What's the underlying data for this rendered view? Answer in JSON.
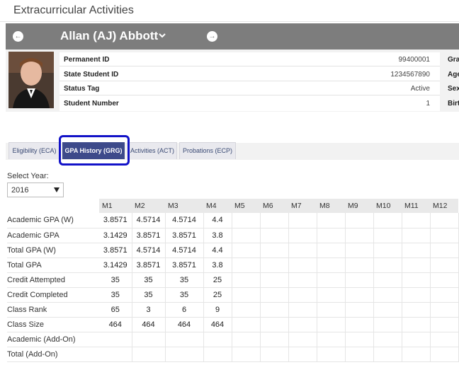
{
  "page": {
    "title": "Extracurricular Activities"
  },
  "student": {
    "name": "Allan (AJ) Abbott",
    "photo_alt": "student photo",
    "fields": [
      {
        "label": "Permanent ID",
        "value": "99400001"
      },
      {
        "label": "State Student ID",
        "value": "1234567890"
      },
      {
        "label": "Status Tag",
        "value": "Active"
      },
      {
        "label": "Student Number",
        "value": "1"
      }
    ],
    "right_labels": [
      "Gra",
      "Age",
      "Sex",
      "Birt"
    ]
  },
  "tabs": [
    {
      "label": "Eligibility (ECA)",
      "active": false
    },
    {
      "label": "GPA History (GRG)",
      "active": true
    },
    {
      "label": "Activities (ACT)",
      "active": false
    },
    {
      "label": "Probations (ECP)",
      "active": false
    }
  ],
  "year": {
    "label": "Select Year:",
    "value": "2016"
  },
  "gpa": {
    "columns": [
      "M1",
      "M2",
      "M3",
      "M4",
      "M5",
      "M6",
      "M7",
      "M8",
      "M9",
      "M10",
      "M11",
      "M12"
    ],
    "rows": [
      {
        "label": "Academic GPA (W)",
        "values": [
          "3.8571",
          "4.5714",
          "4.5714",
          "4.4",
          "",
          "",
          "",
          "",
          "",
          "",
          "",
          ""
        ]
      },
      {
        "label": "Academic GPA",
        "values": [
          "3.1429",
          "3.8571",
          "3.8571",
          "3.8",
          "",
          "",
          "",
          "",
          "",
          "",
          "",
          ""
        ]
      },
      {
        "label": "Total GPA (W)",
        "values": [
          "3.8571",
          "4.5714",
          "4.5714",
          "4.4",
          "",
          "",
          "",
          "",
          "",
          "",
          "",
          ""
        ]
      },
      {
        "label": "Total GPA",
        "values": [
          "3.1429",
          "3.8571",
          "3.8571",
          "3.8",
          "",
          "",
          "",
          "",
          "",
          "",
          "",
          ""
        ]
      },
      {
        "label": "Credit Attempted",
        "values": [
          "35",
          "35",
          "35",
          "25",
          "",
          "",
          "",
          "",
          "",
          "",
          "",
          ""
        ]
      },
      {
        "label": "Credit Completed",
        "values": [
          "35",
          "35",
          "35",
          "25",
          "",
          "",
          "",
          "",
          "",
          "",
          "",
          ""
        ]
      },
      {
        "label": "Class Rank",
        "values": [
          "65",
          "3",
          "6",
          "9",
          "",
          "",
          "",
          "",
          "",
          "",
          "",
          ""
        ]
      },
      {
        "label": "Class Size",
        "values": [
          "464",
          "464",
          "464",
          "464",
          "",
          "",
          "",
          "",
          "",
          "",
          "",
          ""
        ]
      },
      {
        "label": "Academic (Add-On)",
        "values": [
          "",
          "",
          "",
          "",
          "",
          "",
          "",
          "",
          "",
          "",
          "",
          ""
        ]
      },
      {
        "label": "Total (Add-On)",
        "values": [
          "",
          "",
          "",
          "",
          "",
          "",
          "",
          "",
          "",
          "",
          "",
          ""
        ]
      }
    ]
  },
  "colors": {
    "bar": "#7d7d7d",
    "active_tab": "#3d4a8a",
    "highlight": "#1212c8"
  }
}
